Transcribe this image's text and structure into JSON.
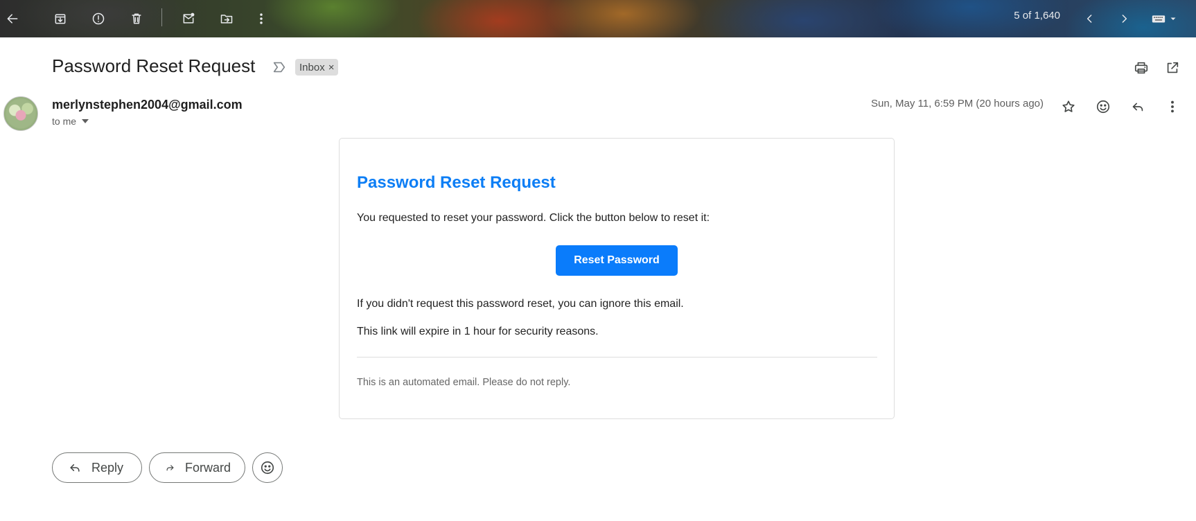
{
  "toolbar": {
    "icons": [
      "back-arrow-icon",
      "archive-icon",
      "report-spam-icon",
      "delete-icon",
      "mark-unread-icon",
      "move-to-icon",
      "more-vert-icon",
      "chevron-left-icon",
      "chevron-right-icon",
      "keyboard-icon"
    ],
    "counter": "5 of 1,640"
  },
  "message": {
    "subject": "Password Reset Request",
    "label_chip": "Inbox",
    "label_remove": "×",
    "sender_email": "merlynstephen2004@gmail.com",
    "recipient_summary": "to me",
    "date": "Sun, May 11, 6:59 PM (20 hours ago)"
  },
  "email_body": {
    "title": "Password Reset Request",
    "intro": "You requested to reset your password. Click the button below to reset it:",
    "button_label": "Reset Password",
    "ignore_note": "If you didn't request this password reset, you can ignore this email.",
    "expiry_note": "This link will expire in 1 hour for security reasons.",
    "footer": "This is an automated email. Please do not reply."
  },
  "actions": {
    "reply_label": "Reply",
    "forward_label": "Forward"
  },
  "colors": {
    "accent_blue": "#0d7ef5",
    "button_blue": "#0a7cfb",
    "text_dark": "#1f1f1f",
    "text_muted": "#5e5e5e",
    "chip_bg": "#dddddd"
  }
}
